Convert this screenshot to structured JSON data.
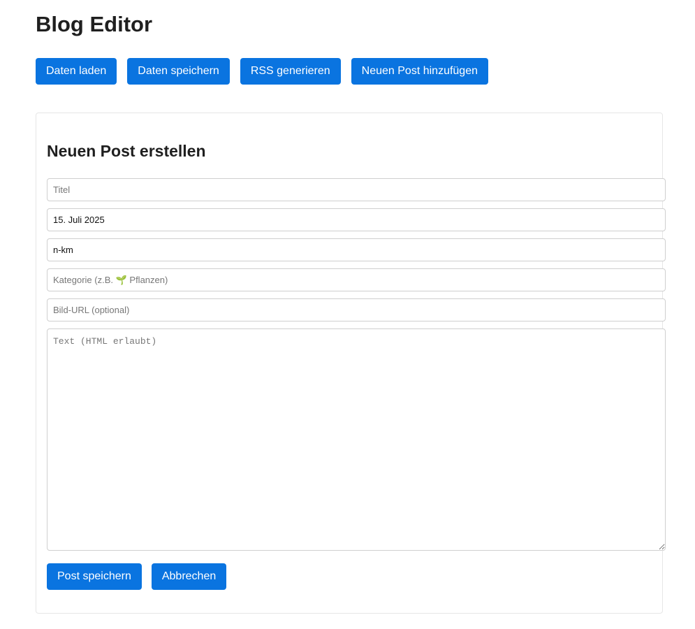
{
  "header": {
    "title": "Blog Editor"
  },
  "toolbar": {
    "load_label": "Daten laden",
    "save_label": "Daten speichern",
    "rss_label": "RSS generieren",
    "add_post_label": "Neuen Post hinzufügen"
  },
  "form": {
    "heading": "Neuen Post erstellen",
    "title": {
      "value": "",
      "placeholder": "Titel"
    },
    "date": {
      "value": "15. Juli 2025",
      "placeholder": ""
    },
    "author": {
      "value": "n-km",
      "placeholder": ""
    },
    "category": {
      "value": "",
      "placeholder": "Kategorie (z.B. 🌱 Pflanzen)"
    },
    "image_url": {
      "value": "",
      "placeholder": "Bild-URL (optional)"
    },
    "text": {
      "value": "",
      "placeholder": "Text (HTML erlaubt)"
    },
    "save_post_label": "Post speichern",
    "cancel_label": "Abbrechen"
  },
  "colors": {
    "accent": "#0a74e0",
    "border": "#cfcfcf",
    "panel_border": "#e6e6e6"
  }
}
